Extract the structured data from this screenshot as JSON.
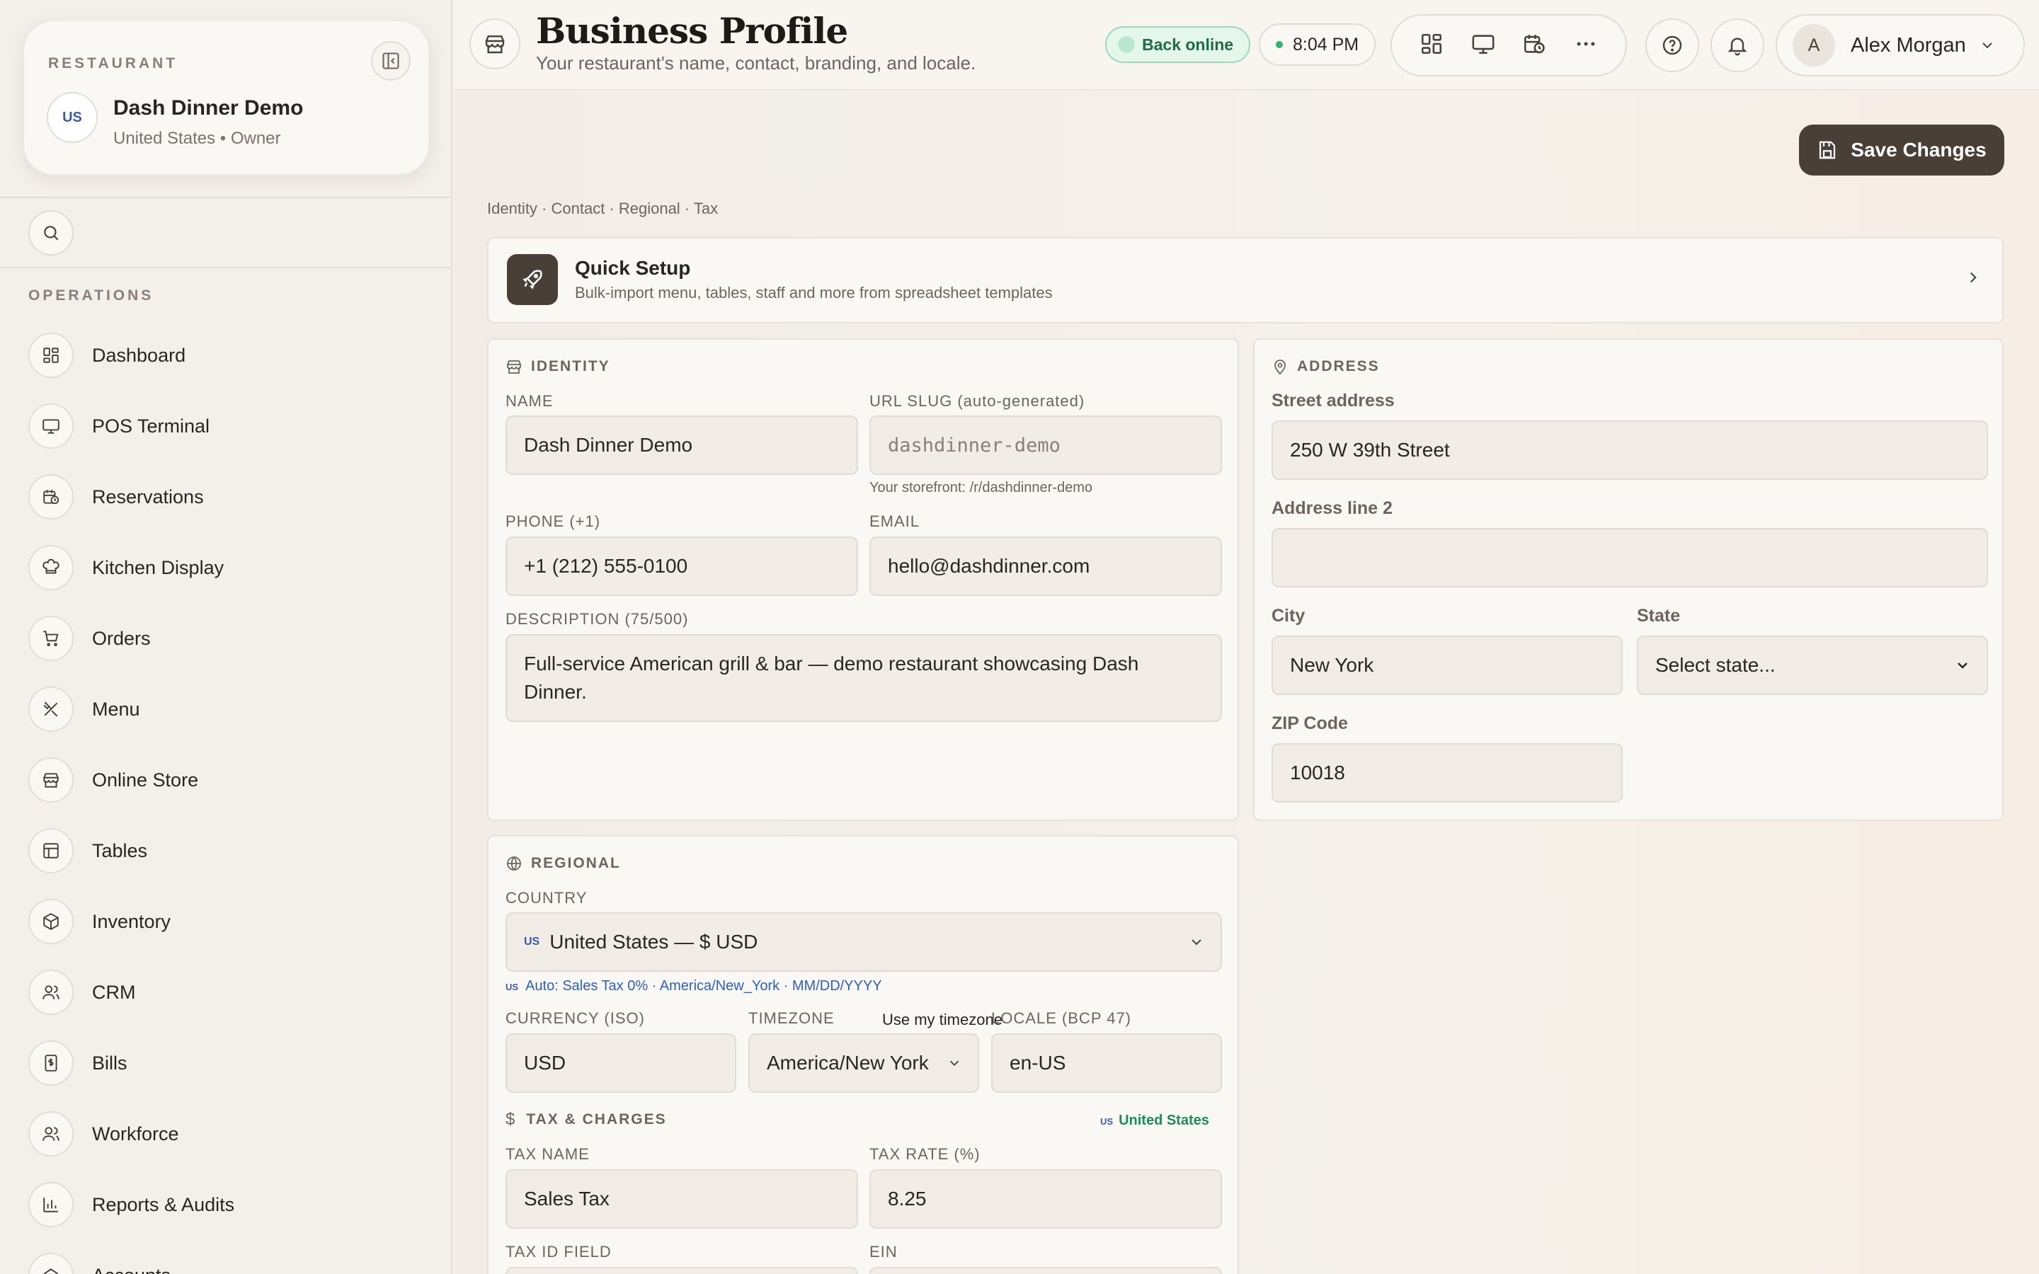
{
  "sidebar": {
    "restaurant_label": "RESTAURANT",
    "restaurant_name": "Dash Dinner Demo",
    "restaurant_sub": "United States • Owner",
    "flag": "US",
    "operations_label": "OPERATIONS",
    "items": [
      {
        "label": "Dashboard",
        "icon": "dashboard-icon"
      },
      {
        "label": "POS Terminal",
        "icon": "monitor-icon"
      },
      {
        "label": "Reservations",
        "icon": "calendar-clock-icon"
      },
      {
        "label": "Kitchen Display",
        "icon": "chef-hat-icon"
      },
      {
        "label": "Orders",
        "icon": "cart-icon"
      },
      {
        "label": "Menu",
        "icon": "utensils-icon"
      },
      {
        "label": "Online Store",
        "icon": "store-icon"
      },
      {
        "label": "Tables",
        "icon": "table-icon"
      },
      {
        "label": "Inventory",
        "icon": "package-icon"
      },
      {
        "label": "CRM",
        "icon": "users-icon"
      },
      {
        "label": "Bills",
        "icon": "receipt-icon"
      },
      {
        "label": "Workforce",
        "icon": "users-icon"
      },
      {
        "label": "Reports & Audits",
        "icon": "bar-chart-icon"
      },
      {
        "label": "Accounts",
        "icon": "bank-icon"
      }
    ]
  },
  "header": {
    "title": "Business Profile",
    "subtitle": "Your restaurant's name, contact, branding, and locale.",
    "status": "Back online",
    "time": "8:04 PM",
    "user_initial": "A",
    "user_name": "Alex Morgan"
  },
  "main": {
    "save_label": "Save Changes",
    "breadcrumb": "Identity · Contact · Regional · Tax",
    "quick_setup": {
      "title": "Quick Setup",
      "subtitle": "Bulk-import menu, tables, staff and more from spreadsheet templates"
    },
    "identity": {
      "title": "IDENTITY",
      "name_label": "NAME",
      "name_value": "Dash Dinner Demo",
      "slug_label": "URL SLUG (auto-generated)",
      "slug_value": "dashdinner-demo",
      "slug_hint": "Your storefront: /r/dashdinner-demo",
      "phone_label": "PHONE (+1)",
      "phone_value": "+1 (212) 555-0100",
      "email_label": "EMAIL",
      "email_value": "hello@dashdinner.com",
      "desc_label": "DESCRIPTION (75/500)",
      "desc_value": "Full-service American grill & bar — demo restaurant showcasing Dash Dinner."
    },
    "address": {
      "title": "ADDRESS",
      "street_label": "Street address",
      "street_value": "250 W 39th Street",
      "line2_label": "Address line 2",
      "line2_value": "",
      "city_label": "City",
      "city_value": "New York",
      "state_label": "State",
      "state_value": "Select state...",
      "zip_label": "ZIP Code",
      "zip_value": "10018"
    },
    "regional": {
      "title": "REGIONAL",
      "country_label": "COUNTRY",
      "country_value": "United States — $ USD",
      "auto_hint": "Auto: Sales Tax 0% · America/New_York · MM/DD/YYYY",
      "currency_label": "CURRENCY (ISO)",
      "currency_value": "USD",
      "timezone_label": "TIMEZONE",
      "timezone_link": "Use my timezone",
      "timezone_value": "America/New York",
      "locale_label": "LOCALE (BCP 47)",
      "locale_value": "en-US"
    },
    "tax": {
      "title": "TAX & CHARGES",
      "country_tag": "United States",
      "tax_name_label": "TAX NAME",
      "tax_name_value": "Sales Tax",
      "tax_rate_label": "TAX RATE (%)",
      "tax_rate_value": "8.25",
      "tax_id_label": "TAX ID FIELD",
      "ein_label": "EIN"
    }
  }
}
